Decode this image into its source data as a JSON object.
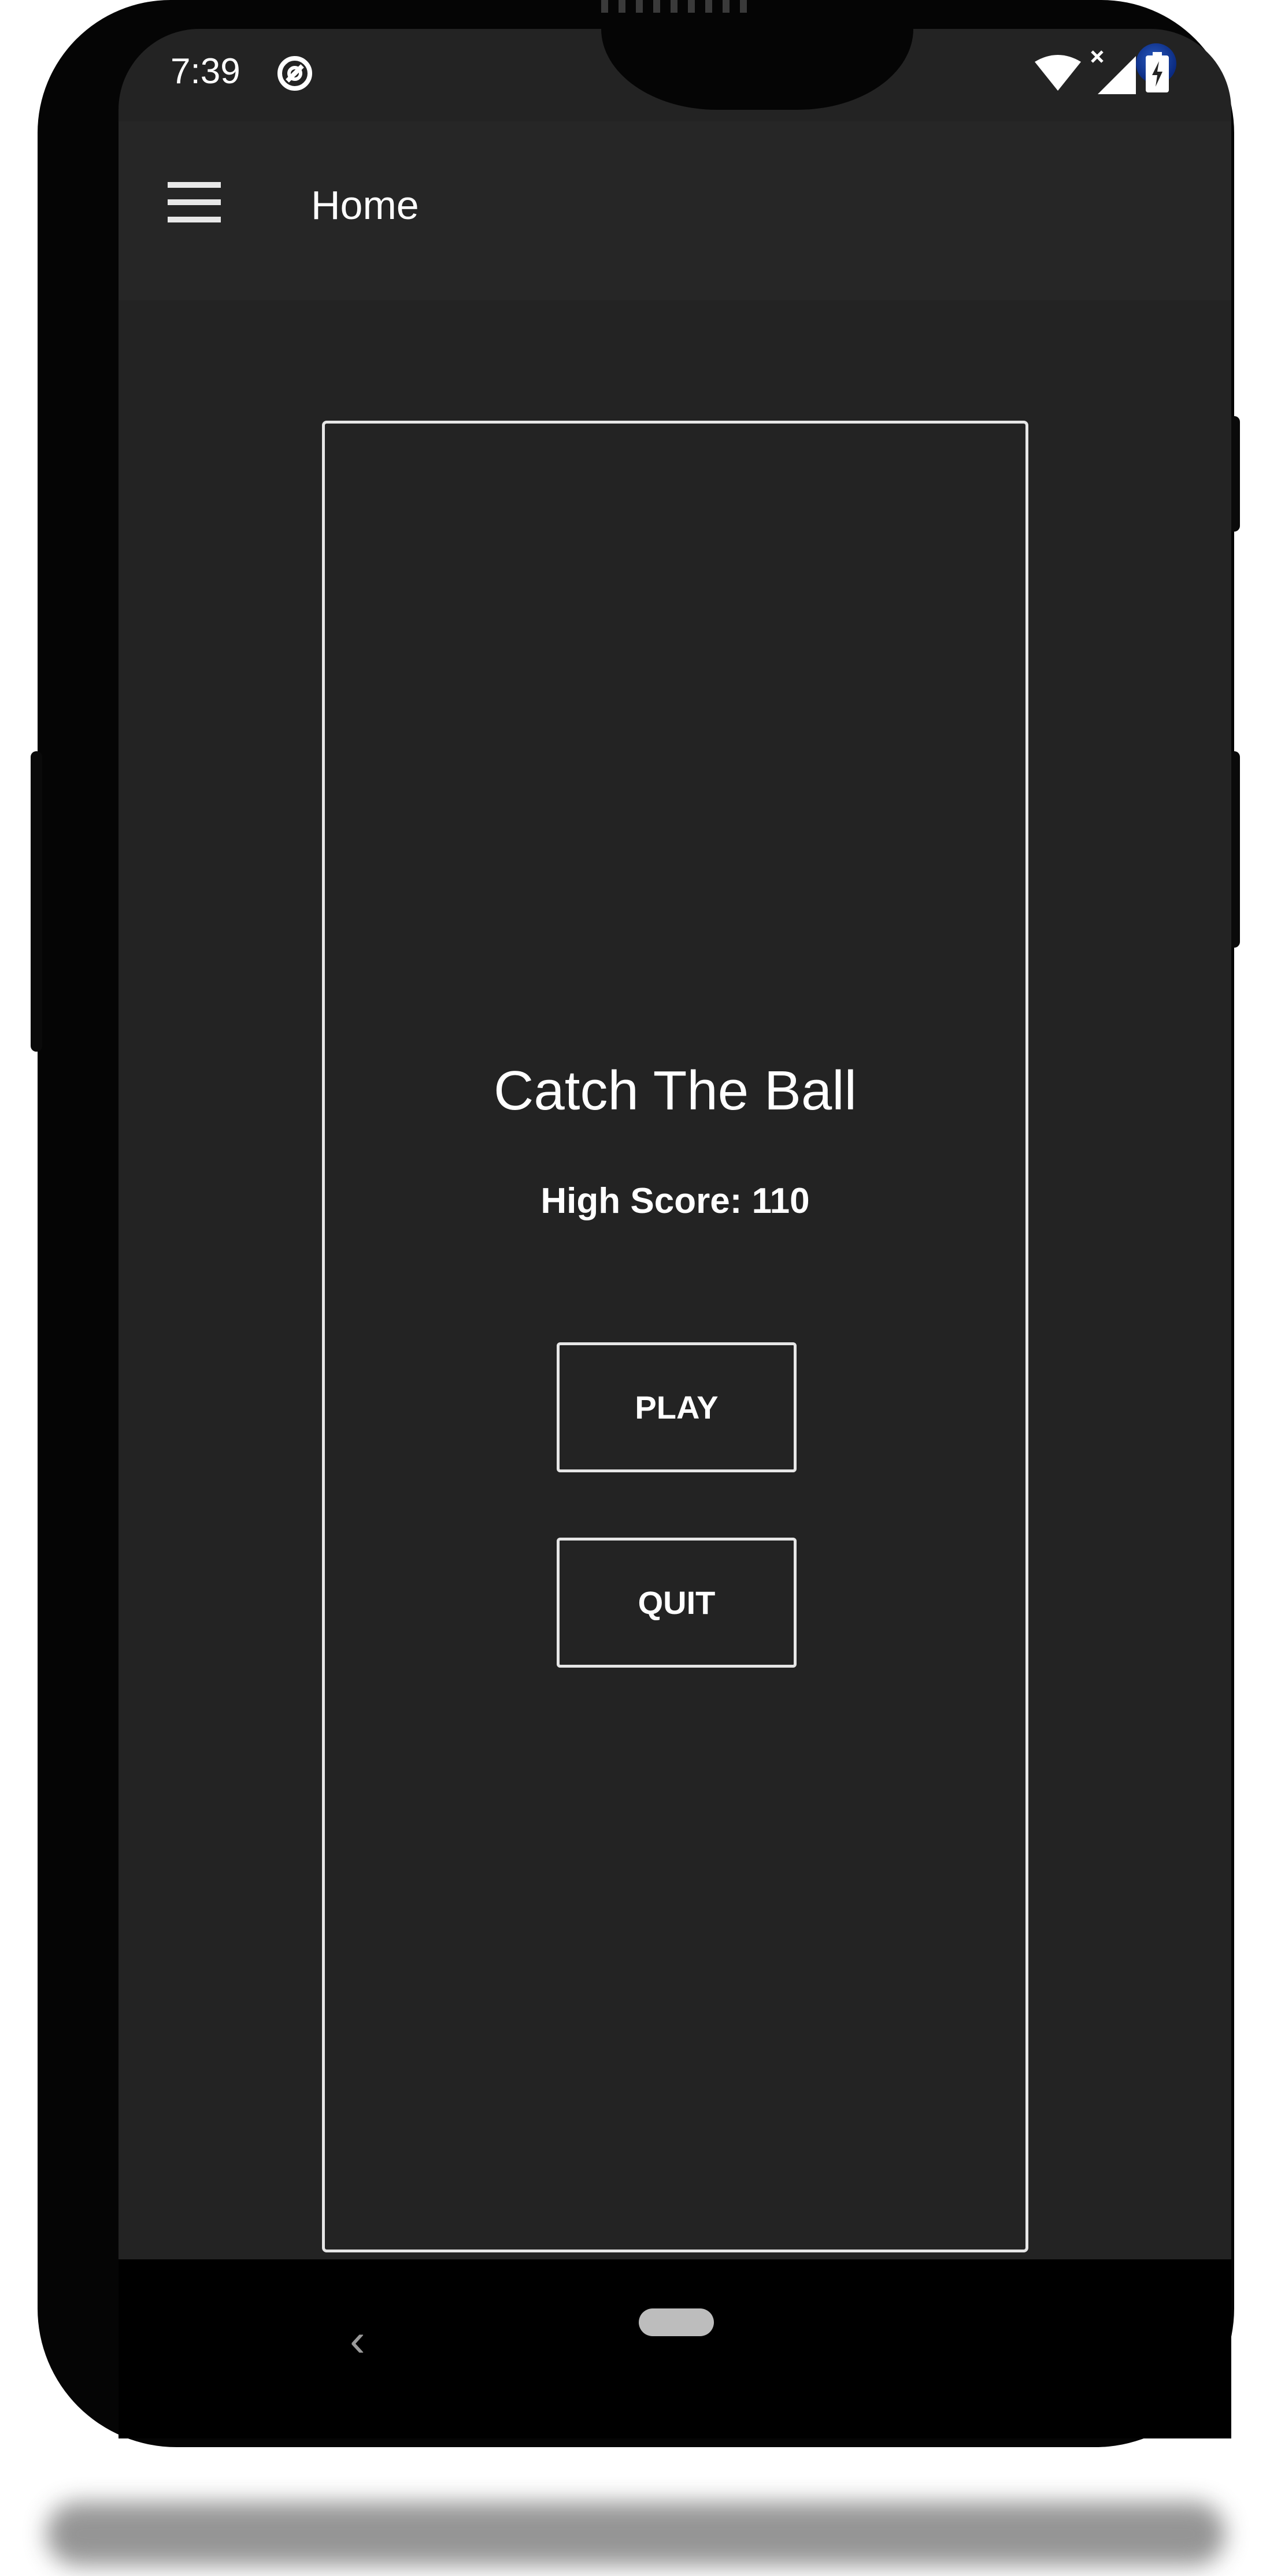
{
  "status_bar": {
    "time": "7:39",
    "icons": [
      "data-saver-icon",
      "wifi-icon",
      "signal-no-data-icon",
      "battery-charging-icon"
    ]
  },
  "app_bar": {
    "title": "Home",
    "menu_icon": "hamburger-menu-icon"
  },
  "game": {
    "title": "Catch The Ball",
    "high_score": "High Score: 110",
    "play_label": "PLAY",
    "quit_label": "QUIT"
  },
  "nav_bar": {
    "back_glyph": "‹"
  },
  "colors": {
    "screen_bg": "#232323",
    "app_bar_bg": "#262626",
    "border": "#e6e6e6",
    "text": "#ffffff",
    "phone_frame": "#050505"
  }
}
